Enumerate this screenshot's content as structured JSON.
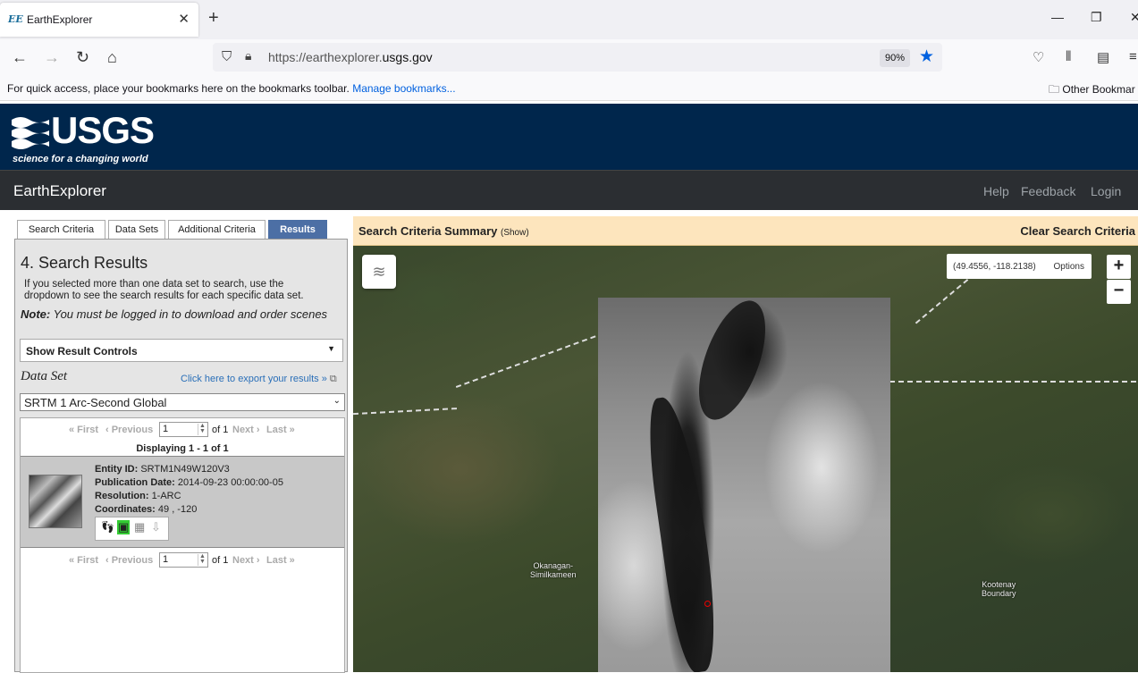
{
  "browser": {
    "tab_title": "EarthExplorer",
    "favicon_text": "EE",
    "url_prefix": "https://earthexplorer.",
    "url_host": "usgs.gov",
    "zoom": "90%",
    "bookmarks_message": "For quick access, place your bookmarks here on the bookmarks toolbar.",
    "bookmarks_link": "Manage bookmarks...",
    "other_bookmarks": "Other Bookmar"
  },
  "header": {
    "logo_word": "USGS",
    "logo_tagline": "science for a changing world",
    "app_title": "EarthExplorer",
    "nav": [
      "Help",
      "Feedback",
      "Login"
    ]
  },
  "left_panel": {
    "tabs": [
      "Search Criteria",
      "Data Sets",
      "Additional Criteria",
      "Results"
    ],
    "heading": "4. Search Results",
    "info": "If you selected more than one data set to search, use the dropdown to see the search results for each specific data set.",
    "note_label": "Note:",
    "note_text": "You must be logged in to download and order scenes",
    "result_controls": "Show Result Controls",
    "dataset_label": "Data Set",
    "export_link": "Click here to export your results »",
    "dataset_selected": "SRTM 1 Arc-Second Global",
    "pager": {
      "first": "« First",
      "previous": "‹ Previous",
      "page_value": "1",
      "of": "of 1",
      "next": "Next ›",
      "last": "Last »"
    },
    "displaying": "Displaying 1 - 1 of 1",
    "result": {
      "entity_label": "Entity ID:",
      "entity_value": "SRTM1N49W120V3",
      "pub_label": "Publication Date:",
      "pub_value": "2014-09-23 00:00:00-05",
      "res_label": "Resolution:",
      "res_value": "1-ARC",
      "coord_label": "Coordinates:",
      "coord_value": "49 , -120"
    }
  },
  "map": {
    "summary_title": "Search Criteria Summary",
    "summary_show": "(Show)",
    "clear": "Clear Search Criteria",
    "coords": "(49.4556, -118.2138)",
    "options": "Options",
    "zoom_in": "+",
    "zoom_out": "−",
    "place1": "Okanagan-\nSimilkameen",
    "place2": "Kootenay\nBoundary"
  }
}
